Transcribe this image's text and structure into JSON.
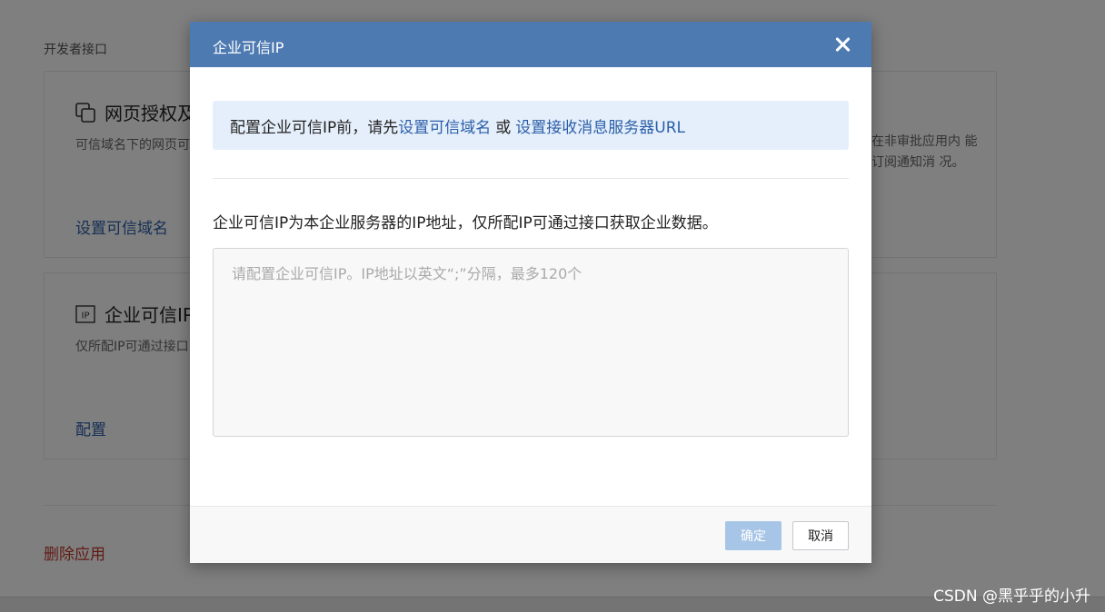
{
  "background": {
    "section_title": "开发者接口",
    "web_card": {
      "title": "网页授权及",
      "desc": "可信域名下的网页可 SDK",
      "link": "设置可信域名",
      "right_desc": "在非审批应用内 能订阅通知消 况。"
    },
    "ip_card": {
      "title": "企业可信IP",
      "desc": "仅所配IP可通过接口",
      "link": "配置"
    },
    "delete_app": "删除应用"
  },
  "modal": {
    "title": "企业可信IP",
    "notice": {
      "prefix": "配置企业可信IP前，请先",
      "link1": "设置可信域名",
      "or": "或",
      "link2": "设置接收消息服务器URL"
    },
    "description": "企业可信IP为本企业服务器的IP地址，仅所配IP可通过接口获取企业数据。",
    "textarea": {
      "value": "",
      "placeholder": "请配置企业可信IP。IP地址以英文“;”分隔，最多120个"
    },
    "confirm_label": "确定",
    "cancel_label": "取消"
  },
  "watermark": "CSDN @黑乎乎的小升",
  "colors": {
    "header": "#4e7ab2",
    "link": "#2b5ea8",
    "notice_bg": "#e5effb",
    "confirm_disabled": "#a7c5e6",
    "danger": "#c0392b"
  },
  "icons": {
    "web_card": "copy-icon",
    "ip_card": "ip-icon",
    "close": "close-icon"
  }
}
